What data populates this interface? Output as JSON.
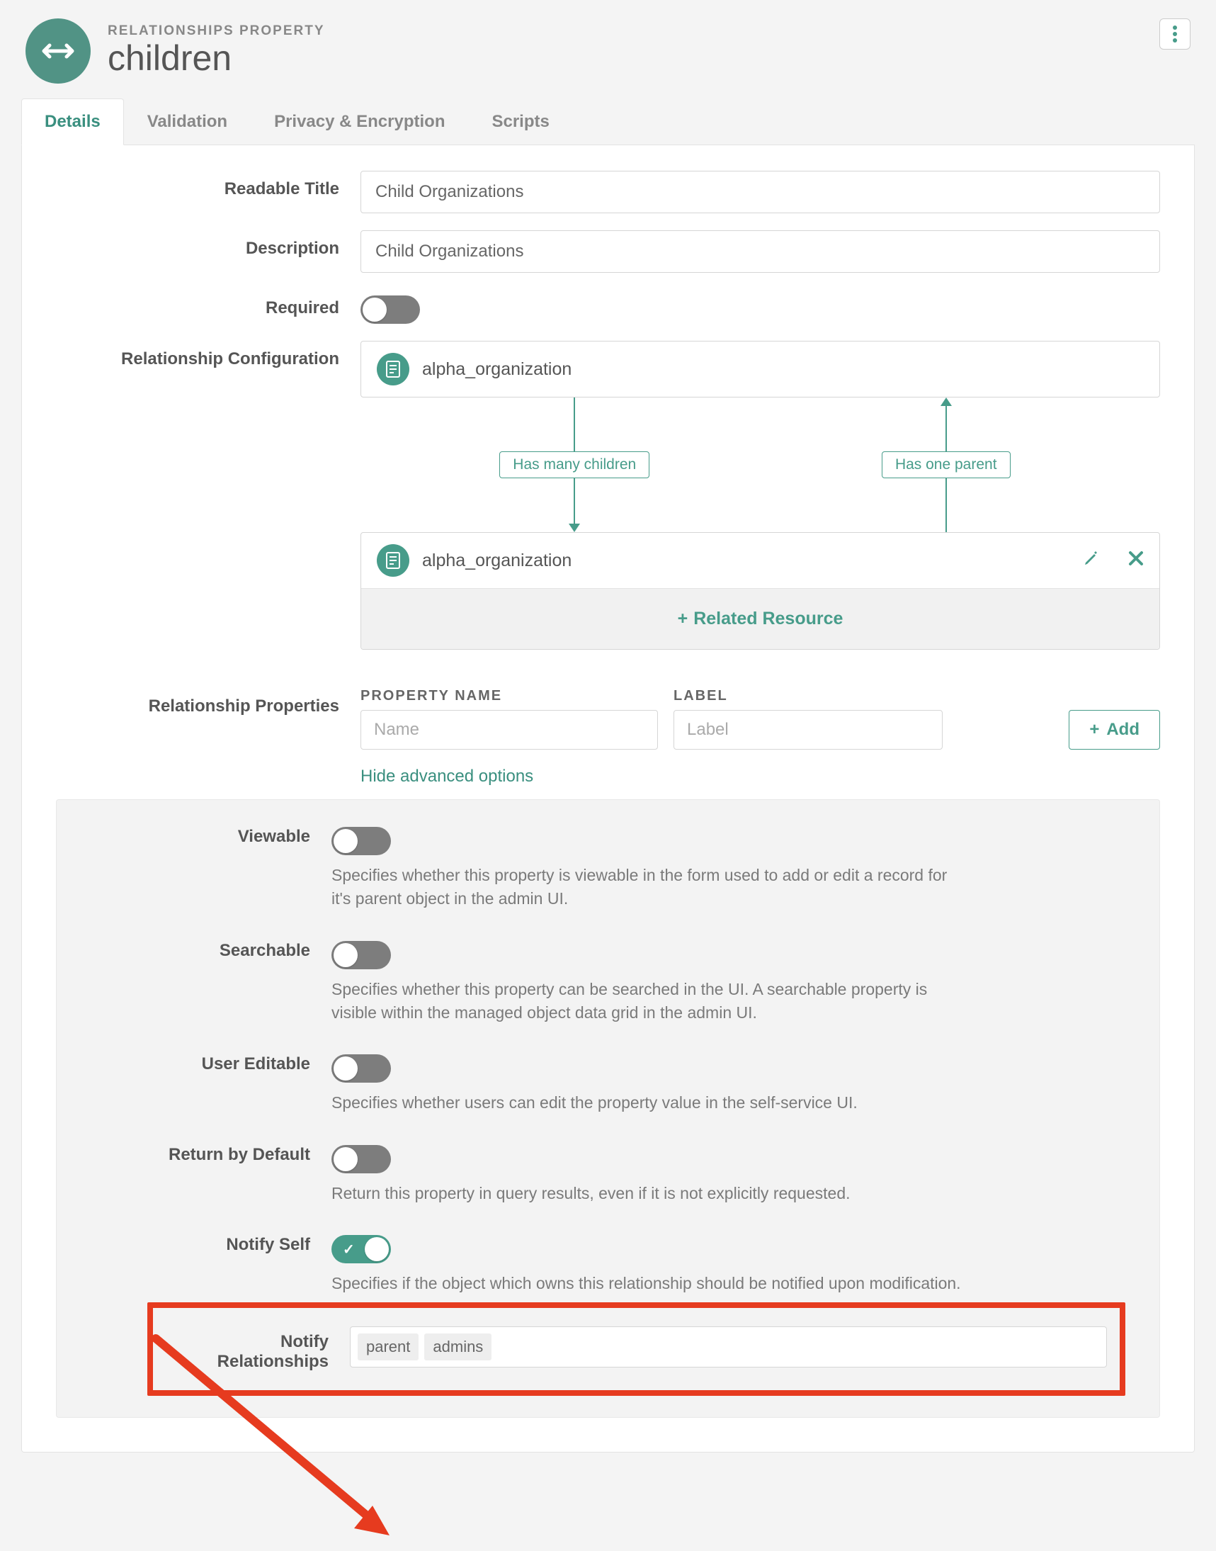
{
  "header": {
    "overline": "RELATIONSHIPS PROPERTY",
    "title": "children"
  },
  "tabs": [
    {
      "label": "Details",
      "active": true
    },
    {
      "label": "Validation",
      "active": false
    },
    {
      "label": "Privacy & Encryption",
      "active": false
    },
    {
      "label": "Scripts",
      "active": false
    }
  ],
  "form": {
    "readable_title": {
      "label": "Readable Title",
      "value": "Child Organizations"
    },
    "description": {
      "label": "Description",
      "value": "Child Organizations"
    },
    "required": {
      "label": "Required",
      "on": false
    },
    "relationship_configuration": {
      "label": "Relationship Configuration",
      "source_resource": "alpha_organization",
      "has_many_label": "Has many children",
      "has_one_label": "Has one parent",
      "target_resource": "alpha_organization",
      "add_related_label": "Related Resource"
    },
    "relationship_properties": {
      "label": "Relationship Properties",
      "header_name": "PROPERTY NAME",
      "header_label": "LABEL",
      "name_placeholder": "Name",
      "label_placeholder": "Label",
      "add_button": "Add"
    },
    "hide_advanced_label": "Hide advanced options",
    "advanced": {
      "viewable": {
        "label": "Viewable",
        "on": false,
        "help": "Specifies whether this property is viewable in the form used to add or edit a record for it's parent object in the admin UI."
      },
      "searchable": {
        "label": "Searchable",
        "on": false,
        "help": "Specifies whether this property can be searched in the UI. A searchable property is visible within the managed object data grid in the admin UI."
      },
      "user_editable": {
        "label": "User Editable",
        "on": false,
        "help": "Specifies whether users can edit the property value in the self-service UI."
      },
      "return_by_default": {
        "label": "Return by Default",
        "on": false,
        "help": "Return this property in query results, even if it is not explicitly requested."
      },
      "notify_self": {
        "label": "Notify Self",
        "on": true,
        "help": "Specifies if the object which owns this relationship should be notified upon modification."
      },
      "notify_relationships": {
        "label": "Notify Relationships",
        "tags": [
          "parent",
          "admins"
        ]
      }
    }
  }
}
